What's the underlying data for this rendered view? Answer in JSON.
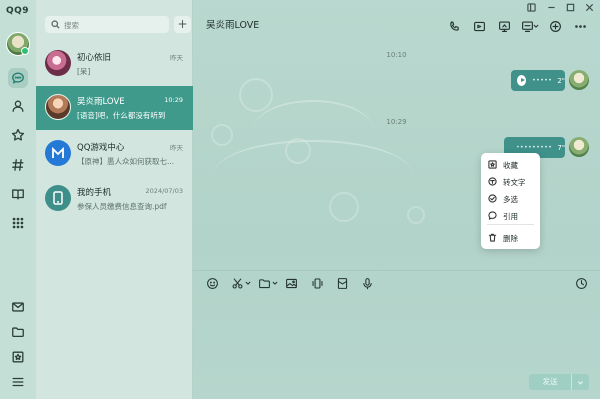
{
  "app": {
    "logo": "QQ9"
  },
  "search": {
    "placeholder": "搜索",
    "add_label": "+"
  },
  "conversations": [
    {
      "name": "初心依旧",
      "time": "昨天",
      "preview": "[呆]"
    },
    {
      "name": "吴炎雨LOVE",
      "time": "10:29",
      "preview": "[语音]吧，什么都没有听到"
    },
    {
      "name": "QQ游戏中心",
      "time": "昨天",
      "preview": "【原神】愚人众如何获取七..."
    },
    {
      "name": "我的手机",
      "time": "2024/07/03",
      "preview": "参保人员缴费信息查询.pdf"
    }
  ],
  "chat": {
    "title": "吴炎雨LOVE",
    "messages": [
      {
        "time": "10:10",
        "type": "voice",
        "waveform": "•••••",
        "duration": "2\""
      },
      {
        "time": "10:29",
        "type": "voice",
        "waveform": "•••••••••",
        "duration": "7\""
      }
    ]
  },
  "context_menu": {
    "items": [
      "收藏",
      "转文字",
      "多选",
      "引用",
      "删除"
    ]
  },
  "input": {
    "send_label": "发送"
  },
  "colors": {
    "accent": "#3f9a8c",
    "bubble": "#3f918a",
    "background": "#b9d8cf"
  }
}
